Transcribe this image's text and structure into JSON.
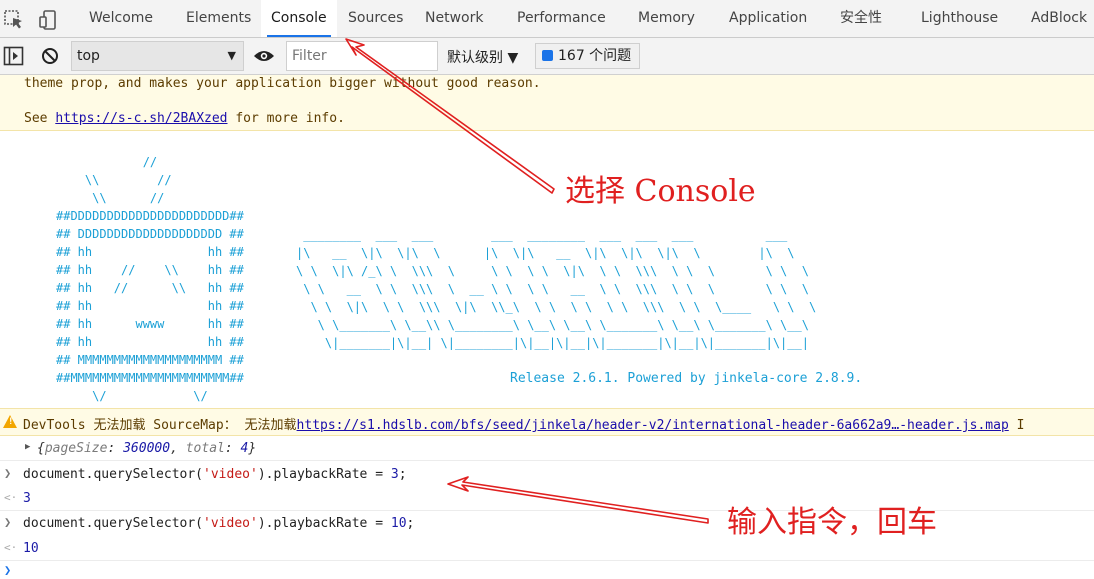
{
  "tabs": [
    "Welcome",
    "Elements",
    "Console",
    "Sources",
    "Network",
    "Performance",
    "Memory",
    "Application",
    "安全性",
    "Lighthouse",
    "AdBlock"
  ],
  "active_tab": "Console",
  "toolbar": {
    "context": "top",
    "filter_placeholder": "Filter",
    "levels": "默认级别 ▼",
    "issues": "167 个问题"
  },
  "warning_box": {
    "line1": "theme prop, and makes your application bigger without good reason.",
    "line2_prefix": "See ",
    "line2_link": "https://s-c.sh/2BAXzed",
    "line2_suffix": " for more info."
  },
  "banner": {
    "ascii_left": "            //\n    \\\\        //\n     \\\\      //\n##DDDDDDDDDDDDDDDDDDDDDD##\n## DDDDDDDDDDDDDDDDDDDD ##\n## hh                hh ##\n## hh    //    \\\\    hh ##\n## hh   //      \\\\   hh ##\n## hh                hh ##\n## hh      wwww      hh ##\n## hh                hh ##\n## MMMMMMMMMMMMMMMMMMMM ##\n##MMMMMMMMMMMMMMMMMMMMMM##\n     \\/            \\/",
    "ascii_right": " ________  ___  ___        ___  ________  ___  ___  ___          ___\n|\\   __  \\|\\  \\|\\  \\      |\\  \\|\\   __  \\|\\  \\|\\  \\|\\  \\        |\\  \\\n\\ \\  \\|\\ /_\\ \\  \\\\\\  \\     \\ \\  \\ \\  \\|\\  \\ \\  \\\\\\  \\ \\  \\       \\ \\  \\\n \\ \\   __  \\ \\  \\\\\\  \\  __ \\ \\  \\ \\   __  \\ \\  \\\\\\  \\ \\  \\       \\ \\  \\\n  \\ \\  \\|\\  \\ \\  \\\\\\  \\|\\  \\\\_\\  \\ \\  \\ \\  \\ \\  \\\\\\  \\ \\  \\____   \\ \\  \\\n   \\ \\_______\\ \\__\\\\ \\________\\ \\__\\ \\__\\ \\_______\\ \\__\\ \\_______\\ \\__\\\n    \\|_______|\\|__| \\|________|\\|__|\\|__|\\|_______|\\|__|\\|_______|\\|__|",
    "release": "Release 2.6.1. Powered by jinkela-core 2.8.9."
  },
  "sourcemap_warning": {
    "prefix": "DevTools 无法加载 SourceMap： 无法加载",
    "link": "https://s1.hdslb.com/bfs/seed/jinkela/header-v2/international-header-6a662a9…-header.js.map",
    "suffix": " I"
  },
  "object_line": {
    "open": "{",
    "k1": "pageSize",
    "v1": "360000",
    "k2": "total",
    "v2": "4",
    "close": "}"
  },
  "commands": [
    {
      "prefix": "document.querySelector(",
      "str": "'video'",
      "mid": ").playbackRate = ",
      "num": "3",
      "end": ";",
      "result": "3"
    },
    {
      "prefix": "document.querySelector(",
      "str": "'video'",
      "mid": ").playbackRate = ",
      "num": "10",
      "end": ";",
      "result": "10"
    }
  ],
  "annotations": {
    "select_console": "选择 Console",
    "enter_command": "输入指令，回车"
  },
  "colors": {
    "accent": "#1a73e8",
    "annotation": "#e02020",
    "ascii": "#1ca0d6",
    "warning_bg": "#fffbe5"
  },
  "icons": [
    "inspect-icon",
    "device-toggle-icon",
    "sidebar-toggle-icon",
    "clear-console-icon",
    "eye-icon",
    "issues-icon",
    "warning-icon"
  ]
}
